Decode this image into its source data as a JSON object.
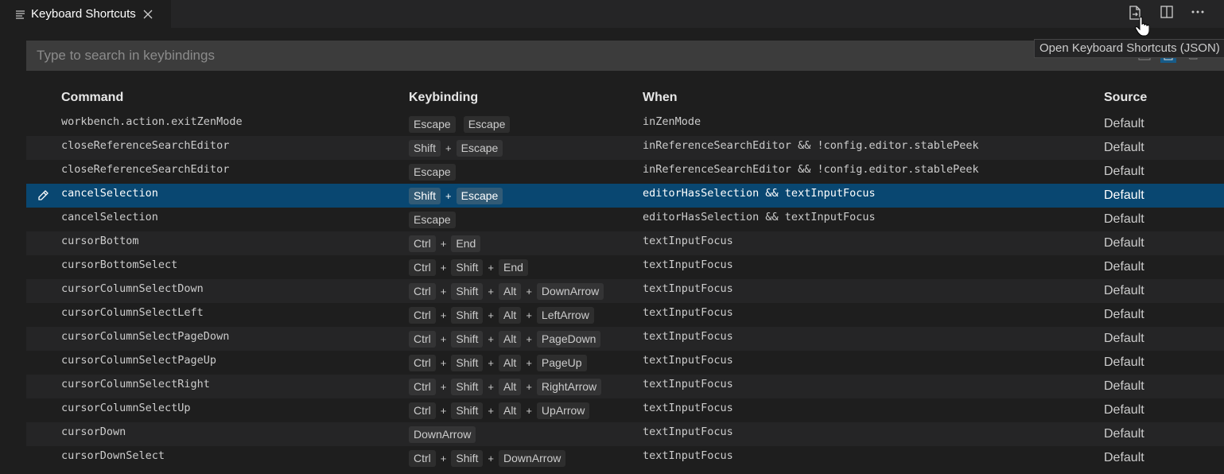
{
  "tab": {
    "title": "Keyboard Shortcuts"
  },
  "actions": {
    "tooltip": "Open Keyboard Shortcuts (JSON)"
  },
  "search": {
    "placeholder": "Type to search in keybindings"
  },
  "columns": {
    "command": "Command",
    "keybinding": "Keybinding",
    "when": "When",
    "source": "Source"
  },
  "rows": [
    {
      "command": "workbench.action.exitZenMode",
      "keys": [
        "Escape",
        " ",
        "Escape"
      ],
      "when": "inZenMode",
      "source": "Default"
    },
    {
      "command": "closeReferenceSearchEditor",
      "keys": [
        "Shift",
        "+",
        "Escape"
      ],
      "when": "inReferenceSearchEditor && !config.editor.stablePeek",
      "source": "Default"
    },
    {
      "command": "closeReferenceSearchEditor",
      "keys": [
        "Escape"
      ],
      "when": "inReferenceSearchEditor && !config.editor.stablePeek",
      "source": "Default"
    },
    {
      "command": "cancelSelection",
      "keys": [
        "Shift",
        "+",
        "Escape"
      ],
      "when": "editorHasSelection && textInputFocus",
      "source": "Default",
      "selected": true
    },
    {
      "command": "cancelSelection",
      "keys": [
        "Escape"
      ],
      "when": "editorHasSelection && textInputFocus",
      "source": "Default"
    },
    {
      "command": "cursorBottom",
      "keys": [
        "Ctrl",
        "+",
        "End"
      ],
      "when": "textInputFocus",
      "source": "Default"
    },
    {
      "command": "cursorBottomSelect",
      "keys": [
        "Ctrl",
        "+",
        "Shift",
        "+",
        "End"
      ],
      "when": "textInputFocus",
      "source": "Default"
    },
    {
      "command": "cursorColumnSelectDown",
      "keys": [
        "Ctrl",
        "+",
        "Shift",
        "+",
        "Alt",
        "+",
        "DownArrow"
      ],
      "when": "textInputFocus",
      "source": "Default"
    },
    {
      "command": "cursorColumnSelectLeft",
      "keys": [
        "Ctrl",
        "+",
        "Shift",
        "+",
        "Alt",
        "+",
        "LeftArrow"
      ],
      "when": "textInputFocus",
      "source": "Default"
    },
    {
      "command": "cursorColumnSelectPageDown",
      "keys": [
        "Ctrl",
        "+",
        "Shift",
        "+",
        "Alt",
        "+",
        "PageDown"
      ],
      "when": "textInputFocus",
      "source": "Default"
    },
    {
      "command": "cursorColumnSelectPageUp",
      "keys": [
        "Ctrl",
        "+",
        "Shift",
        "+",
        "Alt",
        "+",
        "PageUp"
      ],
      "when": "textInputFocus",
      "source": "Default"
    },
    {
      "command": "cursorColumnSelectRight",
      "keys": [
        "Ctrl",
        "+",
        "Shift",
        "+",
        "Alt",
        "+",
        "RightArrow"
      ],
      "when": "textInputFocus",
      "source": "Default"
    },
    {
      "command": "cursorColumnSelectUp",
      "keys": [
        "Ctrl",
        "+",
        "Shift",
        "+",
        "Alt",
        "+",
        "UpArrow"
      ],
      "when": "textInputFocus",
      "source": "Default"
    },
    {
      "command": "cursorDown",
      "keys": [
        "DownArrow"
      ],
      "when": "textInputFocus",
      "source": "Default"
    },
    {
      "command": "cursorDownSelect",
      "keys": [
        "Ctrl",
        "+",
        "Shift",
        "+",
        "DownArrow"
      ],
      "when": "textInputFocus",
      "source": "Default"
    }
  ]
}
